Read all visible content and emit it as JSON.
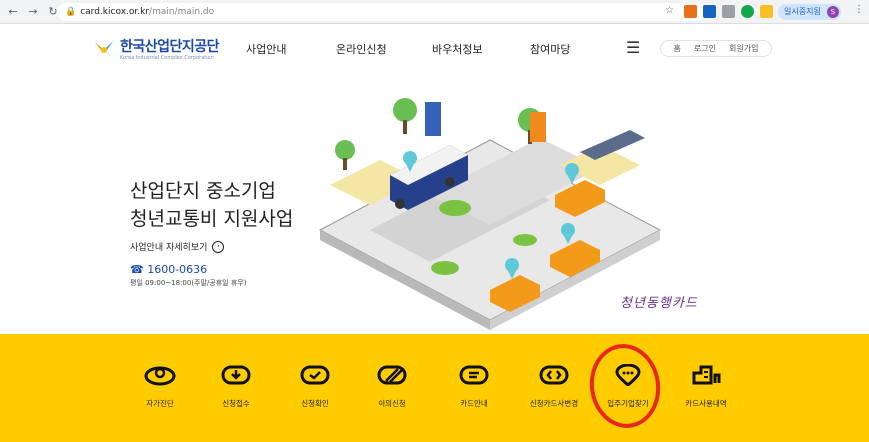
{
  "browser": {
    "url_domain": "card.kicox.or.kr",
    "url_path": "/main/main.do",
    "profile_label": "일시중지됨",
    "profile_initial": "S"
  },
  "header": {
    "logo_name": "한국산업단지공단",
    "logo_sub": "Korea Industrial Complex Corporation",
    "menu": [
      "사업안내",
      "온라인신청",
      "바우처정보",
      "참여마당"
    ],
    "util": [
      "홈",
      "로그인",
      "회원가입"
    ]
  },
  "hero": {
    "title_line1": "산업단지 중소기업",
    "title_line2": "청년교통비 지원사업",
    "detail_link": "사업안내 자세히보기",
    "detail_arrow": "›",
    "phone": "☎ 1600-0636",
    "hours": "평일 09:00~18:00(주말/공휴일 휴무)",
    "slogan": "청년동행카드"
  },
  "services": [
    {
      "label": "자가진단",
      "icon": "self-check-icon"
    },
    {
      "label": "신청접수",
      "icon": "download-icon"
    },
    {
      "label": "신청확인",
      "icon": "check-icon"
    },
    {
      "label": "이의신청",
      "icon": "slash-icon"
    },
    {
      "label": "카드안내",
      "icon": "chat-icon"
    },
    {
      "label": "신청카드사변경",
      "icon": "swap-icon"
    },
    {
      "label": "입주기업찾기",
      "icon": "location-icon"
    },
    {
      "label": "카드사용내역",
      "icon": "building-icon"
    }
  ],
  "colors": {
    "band": "#ffcc00",
    "brand_blue": "#1a4aa8",
    "highlight_ring": "#e8271d"
  }
}
